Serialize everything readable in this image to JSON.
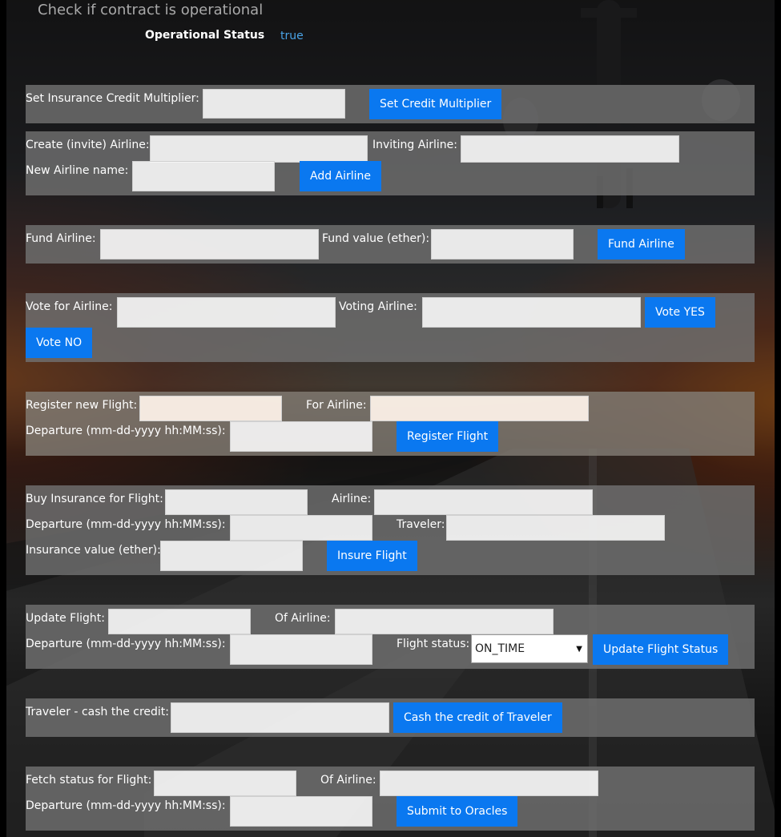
{
  "header": {
    "title": "Check if contract is operational",
    "operational_label": "Operational Status",
    "operational_value": "true"
  },
  "multiplier": {
    "label": "Set Insurance Credit Multiplier:",
    "button": "Set Credit Multiplier"
  },
  "create_airline": {
    "label": "Create (invite) Airline:",
    "inviting_label": "Inviting Airline:",
    "name_label": "New Airline name:",
    "button": "Add Airline"
  },
  "fund_airline": {
    "label": "Fund Airline:",
    "value_label": "Fund value (ether):",
    "button": "Fund Airline"
  },
  "vote": {
    "label": "Vote for Airline:",
    "voting_label": "Voting Airline:",
    "yes_button": "Vote YES",
    "no_button": "Vote NO"
  },
  "register_flight": {
    "label": "Register new Flight:",
    "airline_label": "For Airline:",
    "departure_label": "Departure (mm-dd-yyyy hh:MM:ss):",
    "button": "Register Flight"
  },
  "buy_insurance": {
    "label": "Buy Insurance for Flight:",
    "airline_label": "Airline:",
    "departure_label": "Departure (mm-dd-yyyy hh:MM:ss):",
    "traveler_label": "Traveler:",
    "value_label": "Insurance value (ether):",
    "button": "Insure Flight"
  },
  "update_flight": {
    "label": "Update Flight:",
    "airline_label": "Of Airline:",
    "departure_label": "Departure (mm-dd-yyyy hh:MM:ss):",
    "status_label": "Flight status:",
    "status_value": "ON_TIME",
    "button": "Update Flight Status"
  },
  "cash_credit": {
    "label": "Traveler - cash the credit:",
    "button": "Cash the credit of Traveler"
  },
  "fetch_status": {
    "label": "Fetch status for Flight:",
    "airline_label": "Of Airline:",
    "departure_label": "Departure (mm-dd-yyyy hh:MM:ss):",
    "button": "Submit to Oracles"
  },
  "colors": {
    "button_blue": "#0a78f0",
    "link_blue": "#4aa3e6",
    "panel_gray": "#707070"
  }
}
